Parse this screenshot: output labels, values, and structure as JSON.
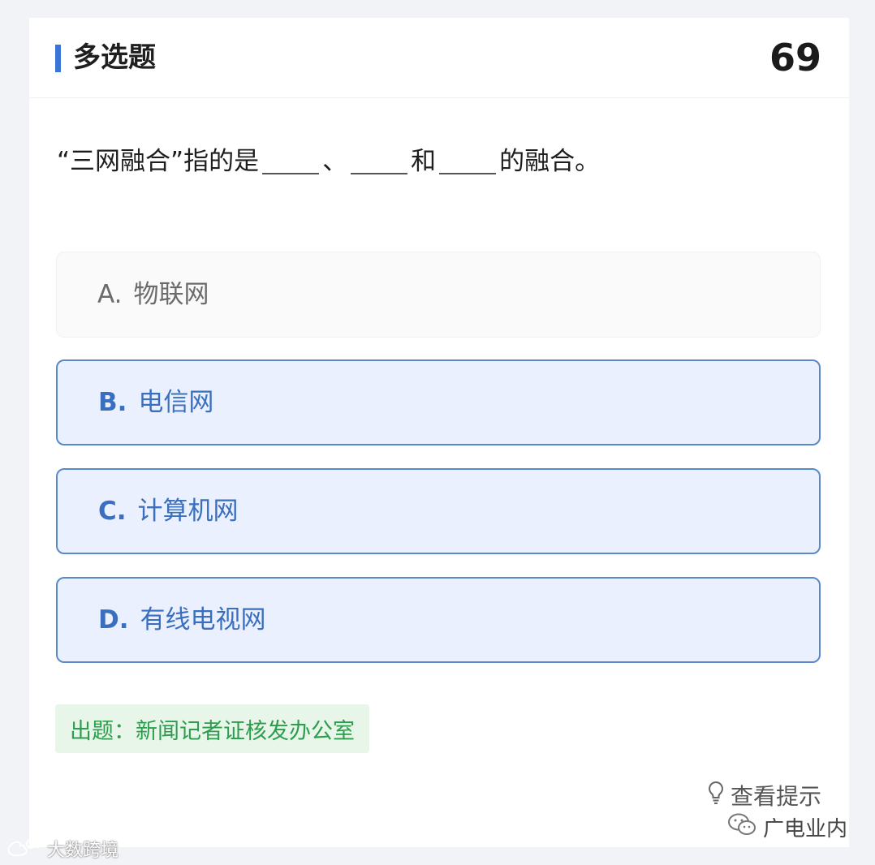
{
  "header": {
    "title": "多选题",
    "question_number": "69"
  },
  "question": {
    "prefix": "“三网融合”指的是",
    "sep1": "、",
    "sep2": "和",
    "suffix": "的融合。"
  },
  "options": [
    {
      "letter": "A.",
      "text": "物联网",
      "selected": false
    },
    {
      "letter": "B.",
      "text": "电信网",
      "selected": true
    },
    {
      "letter": "C.",
      "text": "计算机网",
      "selected": true
    },
    {
      "letter": "D.",
      "text": "有线电视网",
      "selected": true
    }
  ],
  "source": {
    "label": "出题：新闻记者证核发办公室"
  },
  "hint": {
    "icon": "lightbulb-icon",
    "label": "查看提示"
  },
  "watermarks": {
    "right": {
      "icon": "wechat-icon",
      "text": "广电业内"
    },
    "left": {
      "icon": "weibo-icon",
      "text": "大数跨境"
    }
  },
  "colors": {
    "accent": "#3a74d4",
    "selected_bg": "#eaf0fd",
    "selected_border": "#5b88c8",
    "source_green": "#2d9d4d"
  }
}
